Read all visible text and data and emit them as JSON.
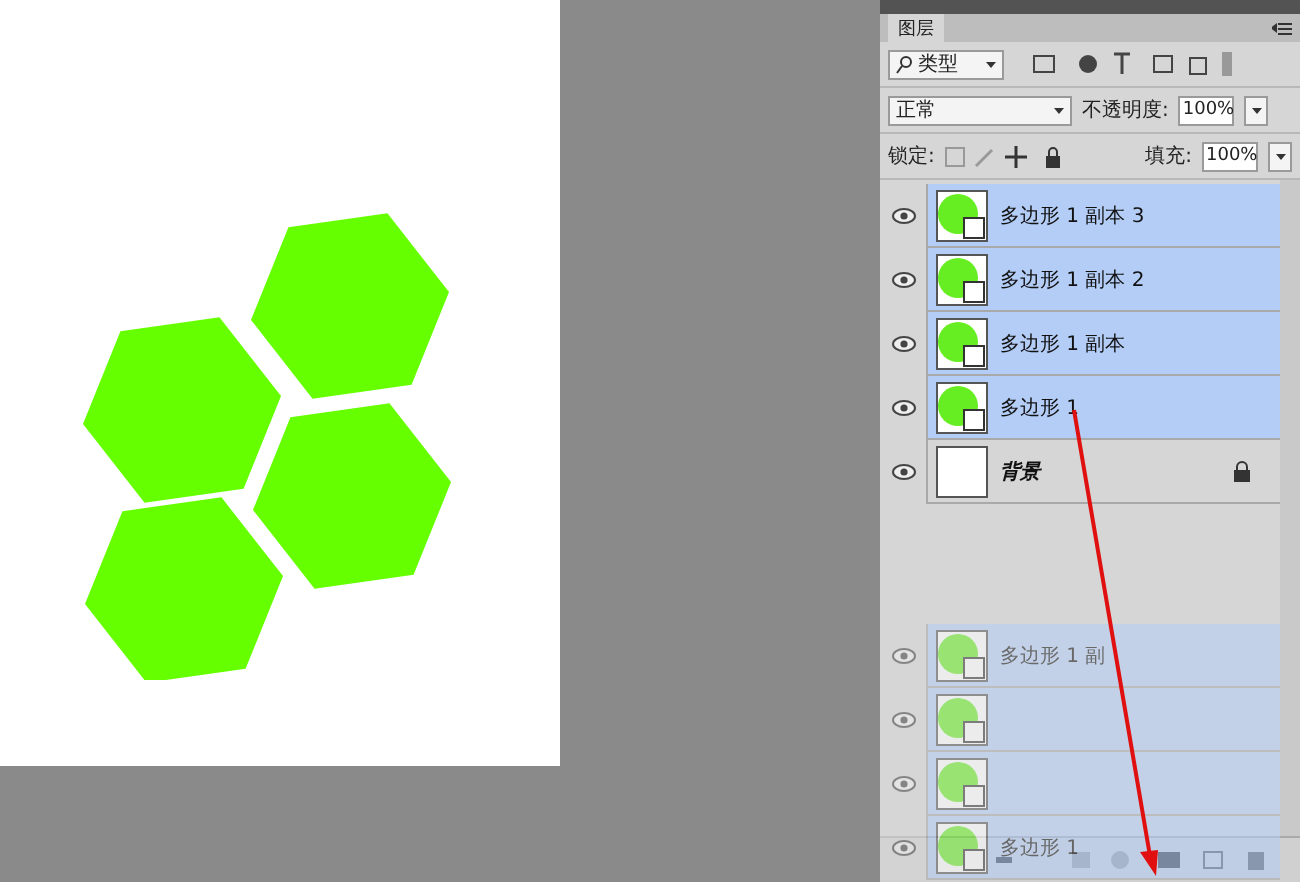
{
  "panel": {
    "tab": "图层",
    "filter": {
      "label": "类型"
    },
    "blend_mode": "正常",
    "opacity": {
      "label": "不透明度:",
      "value": "100%"
    },
    "lock": {
      "label": "锁定:"
    },
    "fill": {
      "label": "填充:",
      "value": "100%"
    }
  },
  "layers": [
    {
      "name": "多边形 1 副本 3",
      "kind": "shape",
      "selected": true,
      "visible": true
    },
    {
      "name": "多边形 1 副本 2",
      "kind": "shape",
      "selected": true,
      "visible": true
    },
    {
      "name": "多边形 1 副本",
      "kind": "shape",
      "selected": true,
      "visible": true
    },
    {
      "name": "多边形 1",
      "kind": "shape",
      "selected": true,
      "visible": true
    },
    {
      "name": "背景",
      "kind": "background",
      "selected": false,
      "visible": true,
      "locked": true
    }
  ],
  "drag_ghost": [
    {
      "kind": "shape",
      "name": "多边形 1 副"
    },
    {
      "kind": "shape"
    },
    {
      "kind": "shape"
    },
    {
      "kind": "shape",
      "name": "多边形 1"
    }
  ]
}
